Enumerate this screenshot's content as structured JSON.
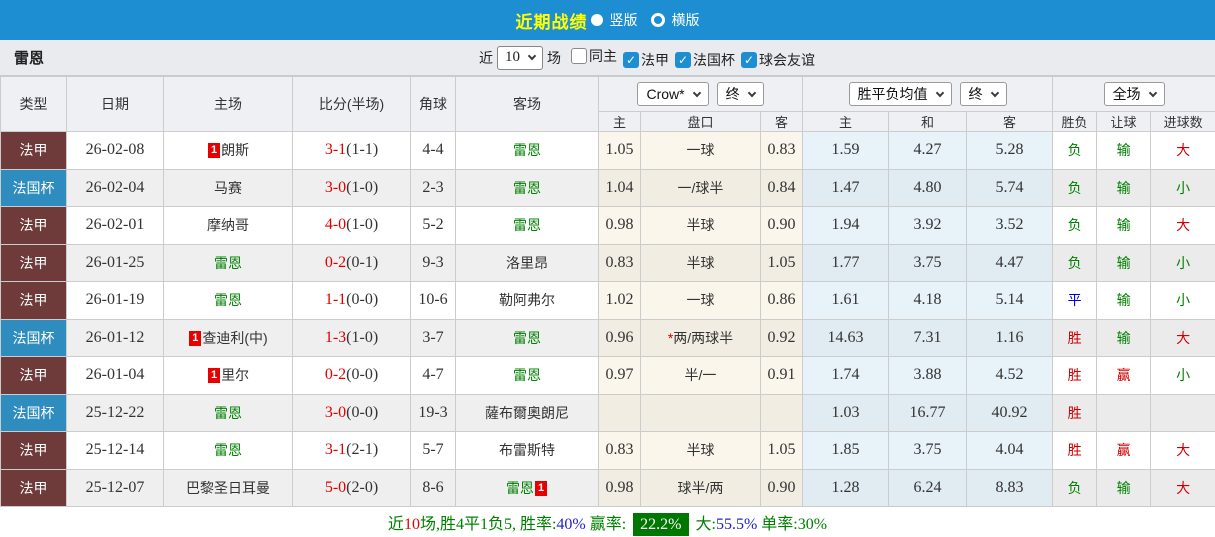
{
  "colors": {
    "accent_blue": "#1e8ed2",
    "title_yellow": "#ffff00",
    "league_maroon": "#6e3a3a",
    "cup_blue": "#2e8cbe",
    "win_red": "#cc0000",
    "lose_green": "#008000",
    "draw_blue": "#0000cc",
    "score_red": "#e00000",
    "badge_red": "#e60000",
    "summary_badge_green": "#007700"
  },
  "title_bar": {
    "title": "近期战绩",
    "vertical_label": "竖版",
    "horizontal_label": "横版"
  },
  "filter_bar": {
    "team": "雷恩",
    "near_label": "近",
    "count_value": "10",
    "matches_label": "场",
    "checkboxes": [
      {
        "key": "same-home",
        "label": "同主",
        "checked": false
      },
      {
        "key": "ligue1",
        "label": "法甲",
        "checked": true
      },
      {
        "key": "coupe-de-france",
        "label": "法国杯",
        "checked": true
      },
      {
        "key": "club-friendly",
        "label": "球会友谊",
        "checked": true
      }
    ]
  },
  "table": {
    "main_headers": [
      "类型",
      "日期",
      "主场",
      "比分(半场)",
      "角球",
      "客场"
    ],
    "dropdowns": {
      "odds_source": "Crow*",
      "odds_time": "终",
      "avg_label": "胜平负均值",
      "avg_time": "终",
      "scope": "全场"
    },
    "sub_headers": [
      "主",
      "盘口",
      "客",
      "主",
      "和",
      "客",
      "胜负",
      "让球",
      "进球数"
    ],
    "rows": [
      {
        "type": "法甲",
        "type_class": "league",
        "date": "26-02-08",
        "home": {
          "text": "朗斯",
          "green": false,
          "badge": "1",
          "badge_pos": "before"
        },
        "score_ft": "3-1",
        "score_ht": "(1-1)",
        "corners": "4-4",
        "away": {
          "text": "雷恩",
          "green": true
        },
        "odds_home": "1.05",
        "handicap": "一球",
        "handicap_star": false,
        "odds_away": "0.83",
        "avg_home": "1.59",
        "avg_draw": "4.27",
        "avg_away": "5.28",
        "result": "负",
        "result_style": "green",
        "handicap_result": "输",
        "handicap_result_style": "green",
        "goals": "大",
        "goals_style": "red"
      },
      {
        "type": "法国杯",
        "type_class": "cup",
        "date": "26-02-04",
        "home": {
          "text": "马赛",
          "green": false
        },
        "score_ft": "3-0",
        "score_ht": "(1-0)",
        "corners": "2-3",
        "away": {
          "text": "雷恩",
          "green": true
        },
        "odds_home": "1.04",
        "handicap": "一/球半",
        "handicap_star": false,
        "odds_away": "0.84",
        "avg_home": "1.47",
        "avg_draw": "4.80",
        "avg_away": "5.74",
        "result": "负",
        "result_style": "green",
        "handicap_result": "输",
        "handicap_result_style": "green",
        "goals": "小",
        "goals_style": "green"
      },
      {
        "type": "法甲",
        "type_class": "league",
        "date": "26-02-01",
        "home": {
          "text": "摩纳哥",
          "green": false
        },
        "score_ft": "4-0",
        "score_ht": "(1-0)",
        "corners": "5-2",
        "away": {
          "text": "雷恩",
          "green": true
        },
        "odds_home": "0.98",
        "handicap": "半球",
        "handicap_star": false,
        "odds_away": "0.90",
        "avg_home": "1.94",
        "avg_draw": "3.92",
        "avg_away": "3.52",
        "result": "负",
        "result_style": "green",
        "handicap_result": "输",
        "handicap_result_style": "green",
        "goals": "大",
        "goals_style": "red"
      },
      {
        "type": "法甲",
        "type_class": "league",
        "date": "26-01-25",
        "home": {
          "text": "雷恩",
          "green": true
        },
        "score_ft": "0-2",
        "score_ht": "(0-1)",
        "corners": "9-3",
        "away": {
          "text": "洛里昂",
          "green": false
        },
        "odds_home": "0.83",
        "handicap": "半球",
        "handicap_star": false,
        "odds_away": "1.05",
        "avg_home": "1.77",
        "avg_draw": "3.75",
        "avg_away": "4.47",
        "result": "负",
        "result_style": "green",
        "handicap_result": "输",
        "handicap_result_style": "green",
        "goals": "小",
        "goals_style": "green"
      },
      {
        "type": "法甲",
        "type_class": "league",
        "date": "26-01-19",
        "home": {
          "text": "雷恩",
          "green": true
        },
        "score_ft": "1-1",
        "score_ht": "(0-0)",
        "corners": "10-6",
        "away": {
          "text": "勒阿弗尔",
          "green": false
        },
        "odds_home": "1.02",
        "handicap": "一球",
        "handicap_star": false,
        "odds_away": "0.86",
        "avg_home": "1.61",
        "avg_draw": "4.18",
        "avg_away": "5.14",
        "result": "平",
        "result_style": "blue",
        "handicap_result": "输",
        "handicap_result_style": "green",
        "goals": "小",
        "goals_style": "green"
      },
      {
        "type": "法国杯",
        "type_class": "cup",
        "date": "26-01-12",
        "home": {
          "text": "查迪利(中)",
          "green": false,
          "badge": "1",
          "badge_pos": "before"
        },
        "score_ft": "1-3",
        "score_ht": "(1-0)",
        "corners": "3-7",
        "away": {
          "text": "雷恩",
          "green": true
        },
        "odds_home": "0.96",
        "handicap": "两/两球半",
        "handicap_star": true,
        "odds_away": "0.92",
        "avg_home": "14.63",
        "avg_draw": "7.31",
        "avg_away": "1.16",
        "result": "胜",
        "result_style": "red",
        "handicap_result": "输",
        "handicap_result_style": "green",
        "goals": "大",
        "goals_style": "red"
      },
      {
        "type": "法甲",
        "type_class": "league",
        "date": "26-01-04",
        "home": {
          "text": "里尔",
          "green": false,
          "badge": "1",
          "badge_pos": "before"
        },
        "score_ft": "0-2",
        "score_ht": "(0-0)",
        "corners": "4-7",
        "away": {
          "text": "雷恩",
          "green": true
        },
        "odds_home": "0.97",
        "handicap": "半/一",
        "handicap_star": false,
        "odds_away": "0.91",
        "avg_home": "1.74",
        "avg_draw": "3.88",
        "avg_away": "4.52",
        "result": "胜",
        "result_style": "red",
        "handicap_result": "赢",
        "handicap_result_style": "red",
        "goals": "小",
        "goals_style": "green"
      },
      {
        "type": "法国杯",
        "type_class": "cup",
        "date": "25-12-22",
        "home": {
          "text": "雷恩",
          "green": true
        },
        "score_ft": "3-0",
        "score_ht": "(0-0)",
        "corners": "19-3",
        "away": {
          "text": "薩布爾奧朗尼",
          "green": false
        },
        "odds_home": "",
        "handicap": "",
        "handicap_star": false,
        "odds_away": "",
        "avg_home": "1.03",
        "avg_draw": "16.77",
        "avg_away": "40.92",
        "result": "胜",
        "result_style": "red",
        "handicap_result": "",
        "handicap_result_style": "",
        "goals": "",
        "goals_style": ""
      },
      {
        "type": "法甲",
        "type_class": "league",
        "date": "25-12-14",
        "home": {
          "text": "雷恩",
          "green": true
        },
        "score_ft": "3-1",
        "score_ht": "(2-1)",
        "corners": "5-7",
        "away": {
          "text": "布雷斯特",
          "green": false
        },
        "odds_home": "0.83",
        "handicap": "半球",
        "handicap_star": false,
        "odds_away": "1.05",
        "avg_home": "1.85",
        "avg_draw": "3.75",
        "avg_away": "4.04",
        "result": "胜",
        "result_style": "red",
        "handicap_result": "赢",
        "handicap_result_style": "red",
        "goals": "大",
        "goals_style": "red"
      },
      {
        "type": "法甲",
        "type_class": "league",
        "date": "25-12-07",
        "home": {
          "text": "巴黎圣日耳曼",
          "green": false
        },
        "score_ft": "5-0",
        "score_ht": "(2-0)",
        "corners": "8-6",
        "away": {
          "text": "雷恩",
          "green": true,
          "badge": "1",
          "badge_pos": "after"
        },
        "odds_home": "0.98",
        "handicap": "球半/两",
        "handicap_star": false,
        "odds_away": "0.90",
        "avg_home": "1.28",
        "avg_draw": "6.24",
        "avg_away": "8.83",
        "result": "负",
        "result_style": "green",
        "handicap_result": "输",
        "handicap_result_style": "green",
        "goals": "大",
        "goals_style": "red"
      }
    ]
  },
  "summary": {
    "segments": [
      {
        "text": "近",
        "style": "green"
      },
      {
        "text": "10",
        "style": "red"
      },
      {
        "text": "场,胜4平1负5, 胜率:",
        "style": "green"
      },
      {
        "text": "40%",
        "style": "blue"
      },
      {
        "text": " 赢率: ",
        "style": "green"
      },
      {
        "text": "22.2%",
        "style": "badge"
      },
      {
        "text": " 大:",
        "style": "green"
      },
      {
        "text": "55.5%",
        "style": "blue"
      },
      {
        "text": " 单率:",
        "style": "green"
      },
      {
        "text": "30%",
        "style": "green"
      }
    ]
  }
}
